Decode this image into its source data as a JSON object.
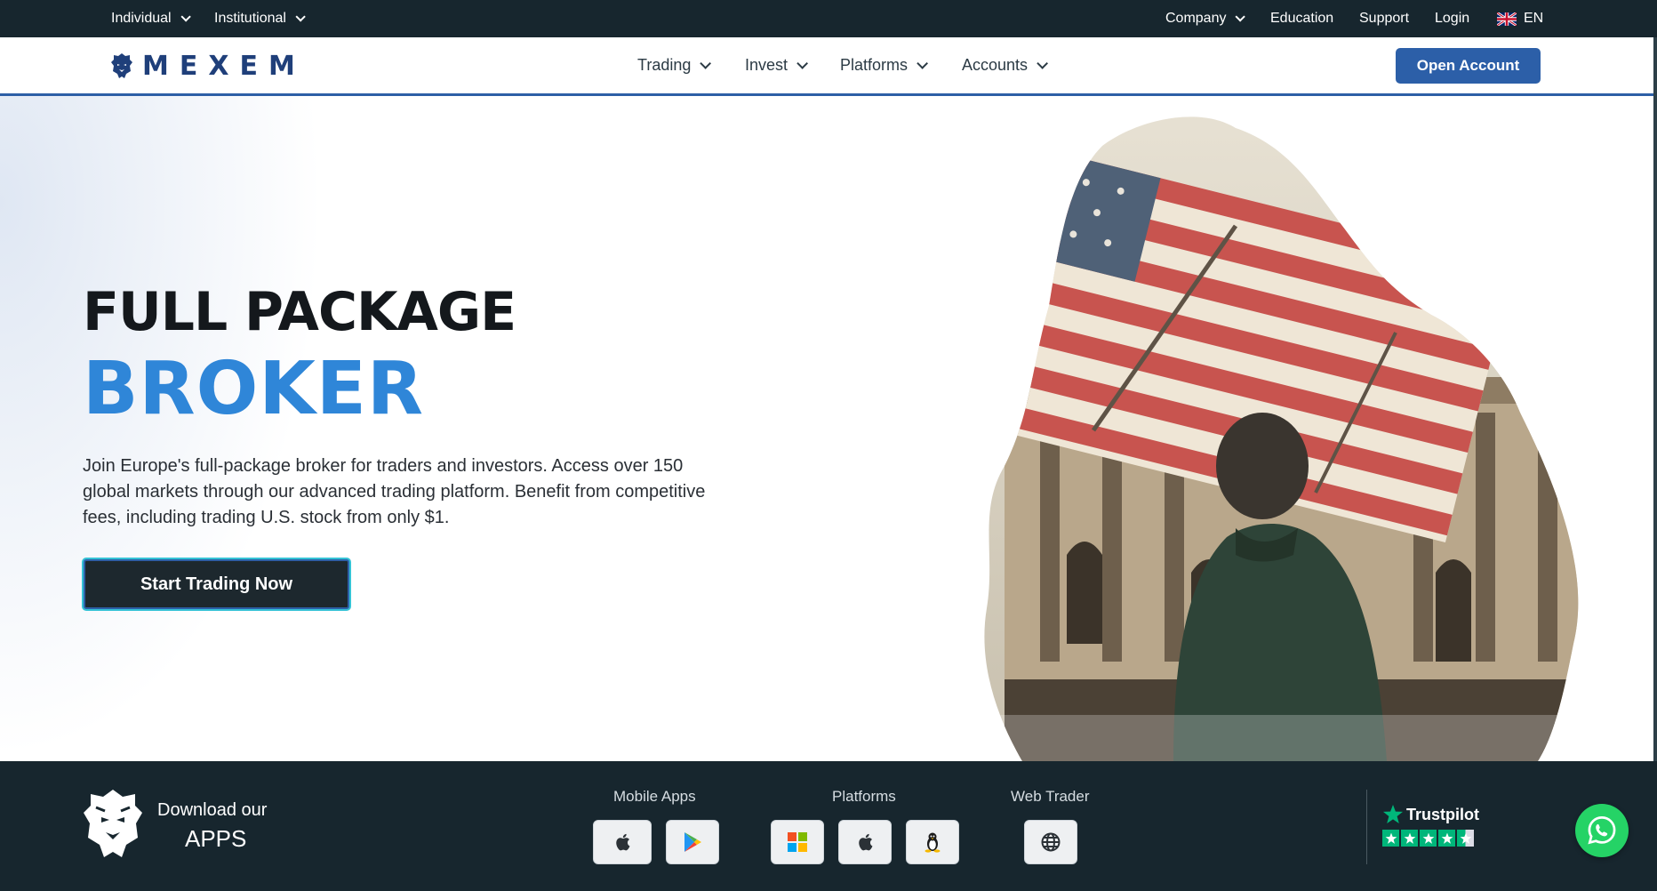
{
  "topbar": {
    "left": [
      {
        "label": "Individual",
        "has_dropdown": true
      },
      {
        "label": "Institutional",
        "has_dropdown": true
      }
    ],
    "right": {
      "company": "Company",
      "education": "Education",
      "support": "Support",
      "login": "Login",
      "language": "EN",
      "language_flag_icon": "uk-flag-icon"
    }
  },
  "nav": {
    "logo_text": "MEXEM",
    "logo_icon": "lion-head-icon",
    "items": [
      {
        "label": "Trading"
      },
      {
        "label": "Invest"
      },
      {
        "label": "Platforms"
      },
      {
        "label": "Accounts"
      }
    ],
    "open_account": "Open Account"
  },
  "hero": {
    "title_line1": "FULL PACKAGE",
    "title_line2": "BROKER",
    "description": "Join Europe's full-package broker for traders and investors. Access over 150 global markets through our advanced trading platform. Benefit from competitive fees, including trading U.S. stock from only $1.",
    "cta": "Start Trading Now"
  },
  "download": {
    "line1": "Download our",
    "line2": "APPS",
    "groups": {
      "mobile": {
        "label": "Mobile Apps",
        "icons": [
          "apple-icon",
          "google-play-icon"
        ]
      },
      "platforms": {
        "label": "Platforms",
        "icons": [
          "windows-icon",
          "apple-icon",
          "linux-icon"
        ]
      },
      "web": {
        "label": "Web Trader",
        "icons": [
          "globe-icon"
        ]
      }
    }
  },
  "trustpilot": {
    "name": "Trustpilot",
    "rating_stars": 4.5,
    "max_stars": 5
  },
  "whatsapp": {
    "icon": "whatsapp-icon"
  },
  "colors": {
    "dark_bar": "#17262e",
    "brand_blue": "#2c5fa8",
    "hero_accent": "#2f86d8",
    "trustpilot_green": "#00b67a",
    "whatsapp_green": "#25d366"
  }
}
